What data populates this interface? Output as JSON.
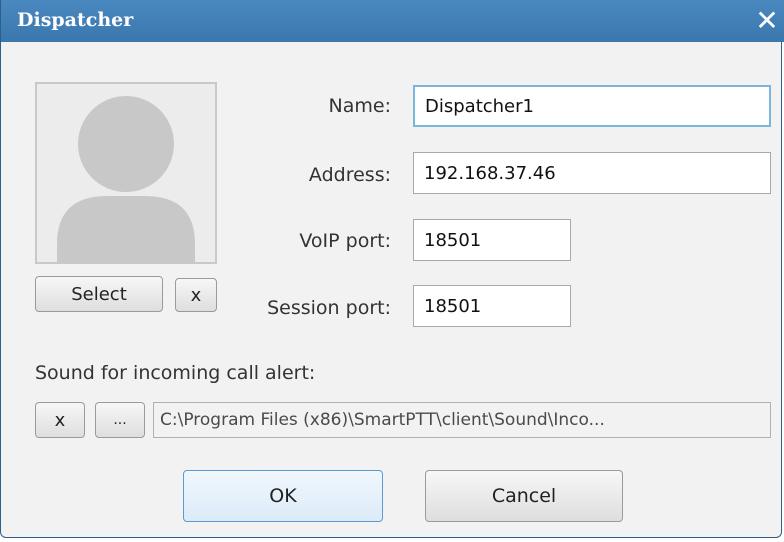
{
  "window": {
    "title": "Dispatcher"
  },
  "buttons": {
    "select_label": "Select",
    "clear_avatar_label": "x",
    "clear_sound_label": "x",
    "browse_sound_label": "...",
    "ok_label": "OK",
    "cancel_label": "Cancel"
  },
  "form": {
    "name": {
      "label": "Name:",
      "value": "Dispatcher1"
    },
    "address": {
      "label": "Address:",
      "value": "192.168.37.46"
    },
    "voip_port": {
      "label": "VoIP port:",
      "value": "18501"
    },
    "session_port": {
      "label": "Session port:",
      "value": "18501"
    }
  },
  "sound": {
    "label": "Sound for incoming call alert:",
    "path": "C:\\Program Files (x86)\\SmartPTT\\client\\Sound\\Inco..."
  },
  "icons": {
    "close": "close-icon",
    "avatar": "person-placeholder-icon"
  },
  "colors": {
    "titlebar": "#3d7ab3",
    "focus_border": "#7cb4e0",
    "background": "#f2f2f2"
  }
}
